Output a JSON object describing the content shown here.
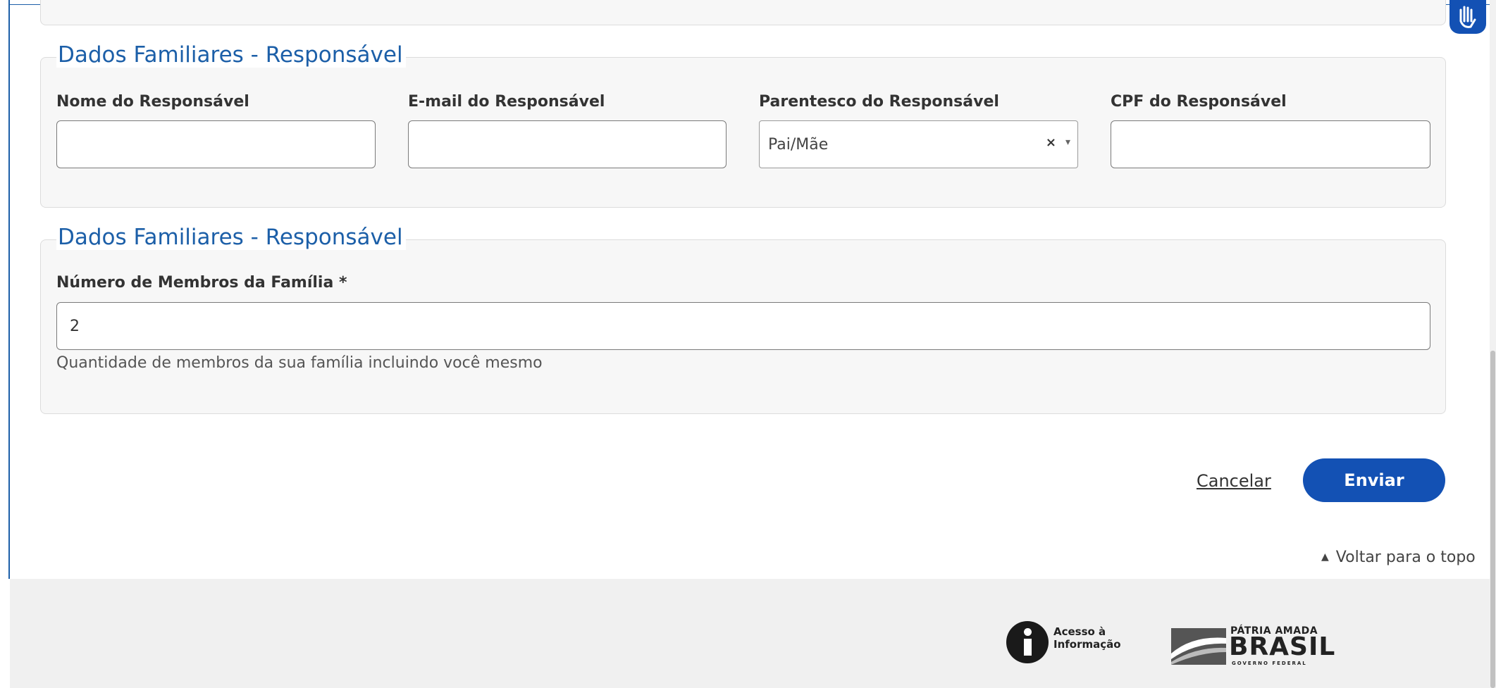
{
  "section_responsavel": {
    "legend": "Dados Familiares - Responsável",
    "nome_label": "Nome do Responsável",
    "nome_value": "",
    "email_label": "E-mail do Responsável",
    "email_value": "",
    "parentesco_label": "Parentesco do Responsável",
    "parentesco_value": "Pai/Mãe",
    "parentesco_clear": "×",
    "parentesco_arrow": "▾",
    "cpf_label": "CPF do Responsável",
    "cpf_value": ""
  },
  "section_membros": {
    "legend": "Dados Familiares - Responsável",
    "membros_label": "Número de Membros da Família *",
    "membros_value": "2",
    "membros_help": "Quantidade de membros da sua família incluindo você mesmo"
  },
  "actions": {
    "cancel_label": "Cancelar",
    "submit_label": "Enviar",
    "back_to_top_arrow": "▲",
    "back_to_top_label": "Voltar para o topo"
  },
  "footer": {
    "acesso_line1": "Acesso à",
    "acesso_line2": "Informação",
    "brasil_top": "PÁTRIA AMADA",
    "brasil_big": "BRASIL",
    "brasil_sub": "GOVERNO FEDERAL"
  },
  "colors": {
    "primary": "#1351b4",
    "legend": "#1c5fa8",
    "panel_bg": "#f7f7f7",
    "footer_bg": "#f0f0f0"
  },
  "icons": {
    "libras": "vlibras-hand-icon",
    "acesso": "acesso-informacao-icon",
    "brasil": "patria-amada-brasil-logo"
  }
}
